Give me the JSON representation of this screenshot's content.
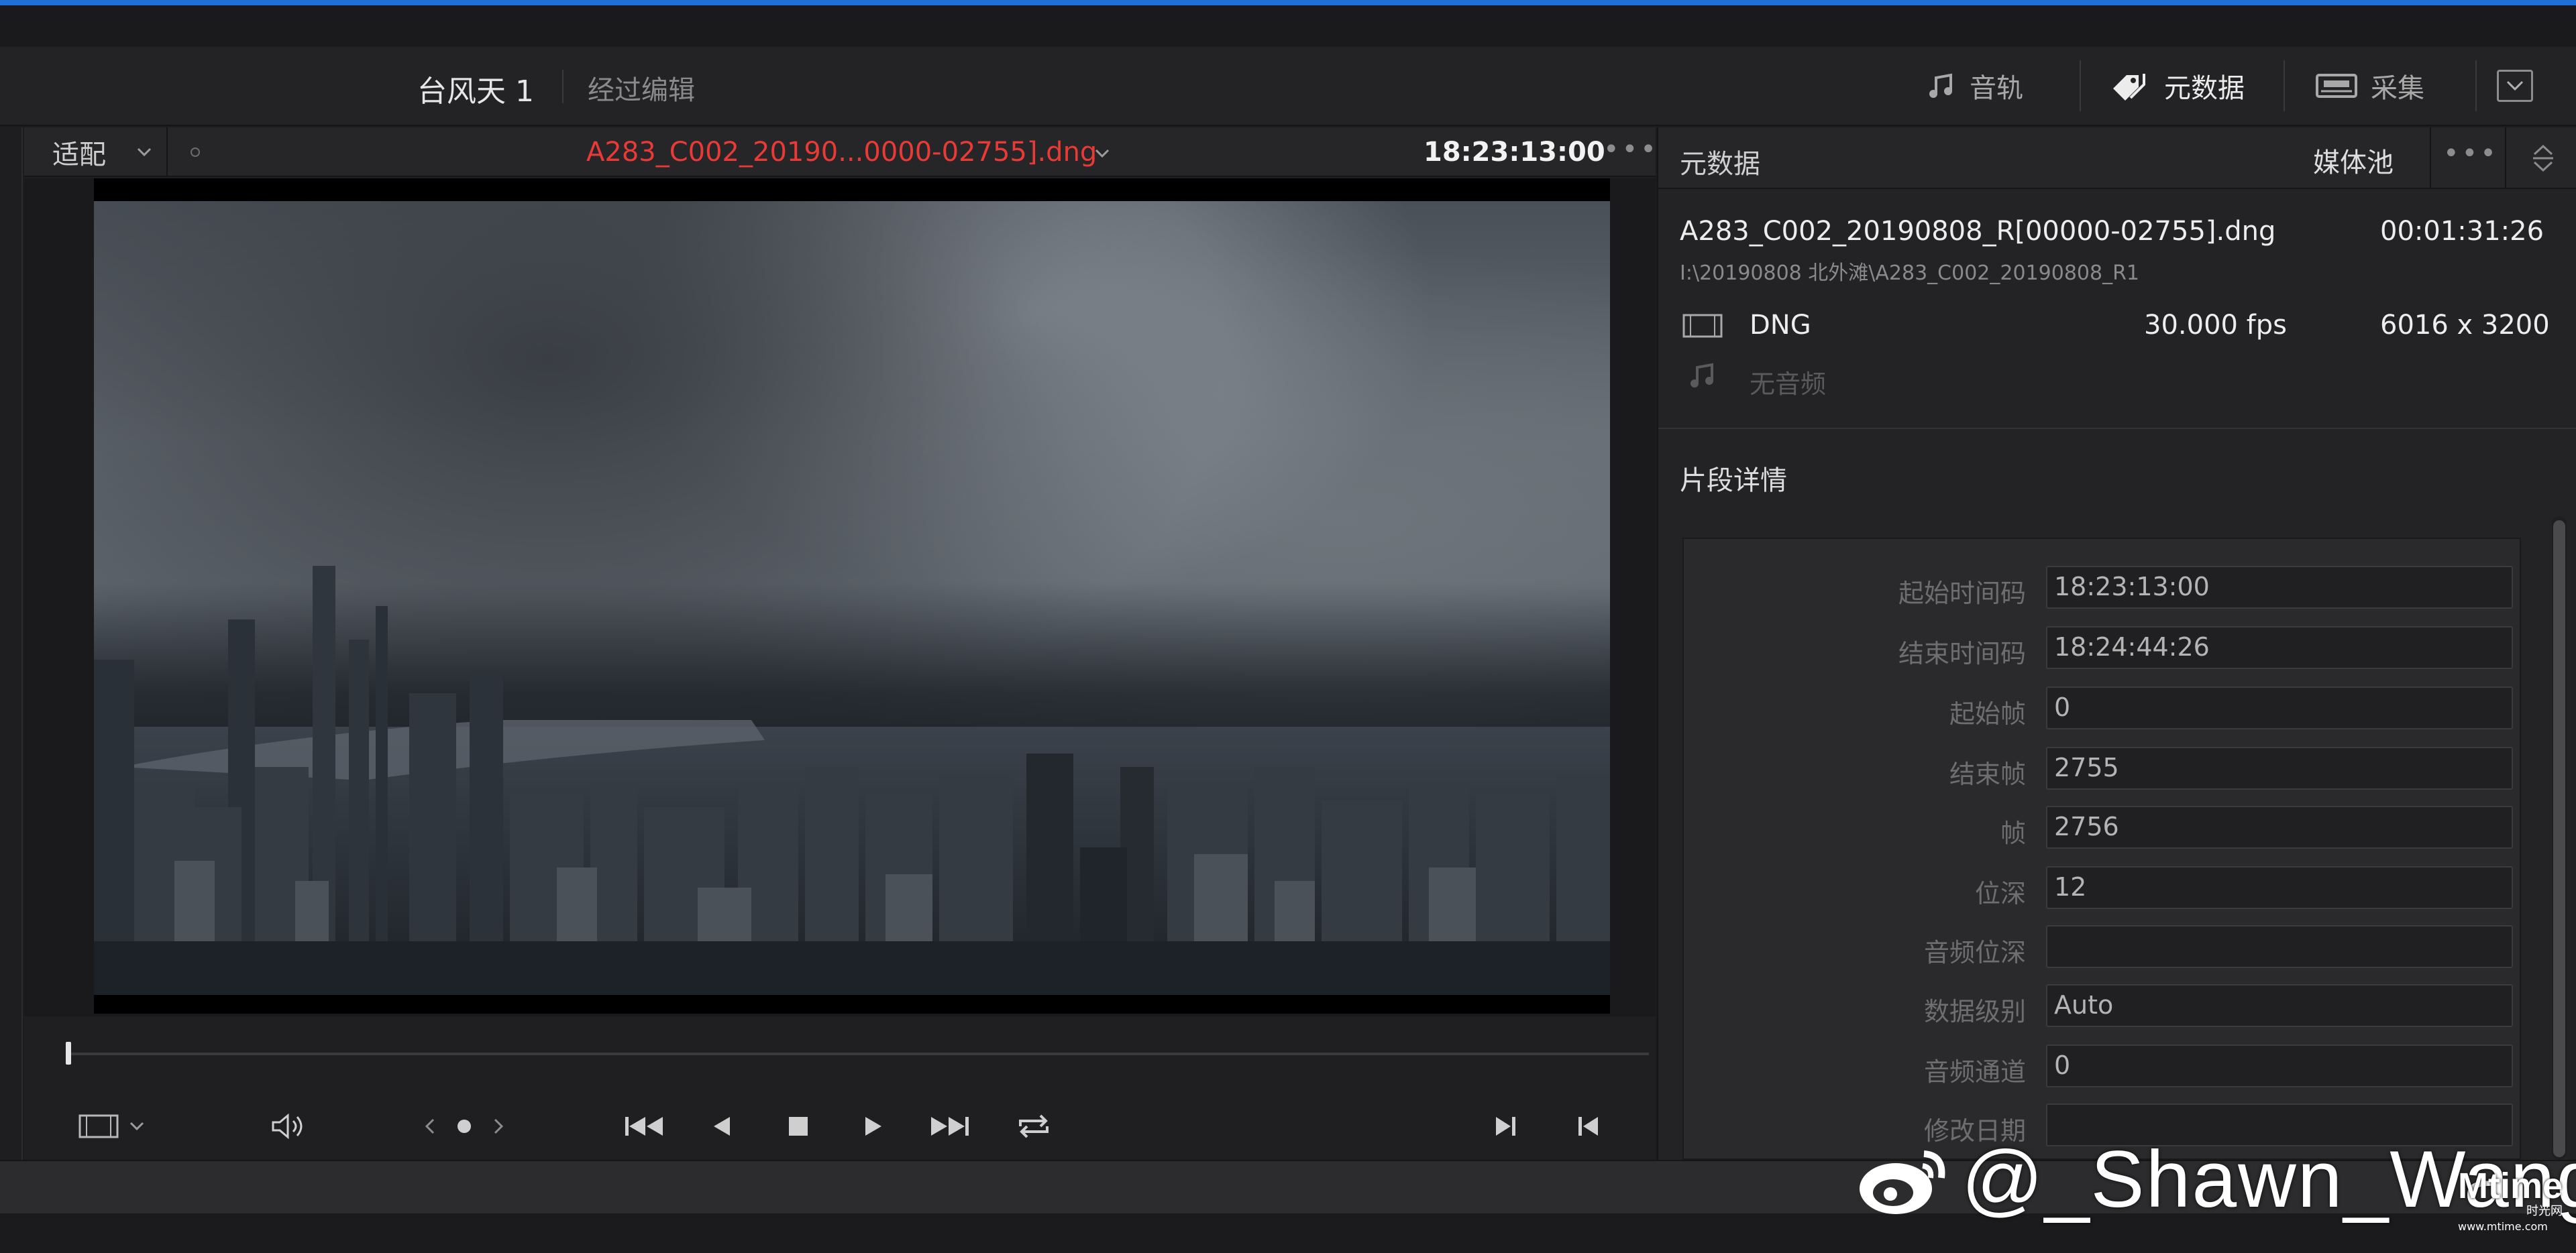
{
  "project": {
    "name": "台风天 1",
    "status": "经过编辑"
  },
  "header": {
    "audio_label": "音轨",
    "metadata_label": "元数据",
    "capture_label": "采集"
  },
  "viewer": {
    "fit_label": "适配",
    "clip_title": "A283_C002_20190...0000-02755].dng",
    "timecode": "18:23:13:00",
    "more_label": "•••"
  },
  "metadata_panel": {
    "title": "元数据",
    "media_pool_label": "媒体池",
    "more_label": "•••",
    "clip": {
      "name": "A283_C002_20190808_R[00000-02755].dng",
      "path": "I:\\20190808 北外滩\\A283_C002_20190808_R1",
      "duration": "00:01:31:26",
      "format": "DNG",
      "fps": "30.000 fps",
      "resolution": "6016 x 3200",
      "audio": "无音频"
    },
    "section_title": "片段详情",
    "fields": [
      {
        "label": "起始时间码",
        "value": "18:23:13:00"
      },
      {
        "label": "结束时间码",
        "value": "18:24:44:26"
      },
      {
        "label": "起始帧",
        "value": "0"
      },
      {
        "label": "结束帧",
        "value": "2755"
      },
      {
        "label": "帧",
        "value": "2756"
      },
      {
        "label": "位深",
        "value": "12"
      },
      {
        "label": "音频位深",
        "value": ""
      },
      {
        "label": "数据级别",
        "value": "Auto"
      },
      {
        "label": "音频通道",
        "value": "0"
      },
      {
        "label": "修改日期",
        "value": ""
      }
    ]
  },
  "watermark": {
    "text": "@_Shawn_Wang",
    "site": "Mtime",
    "site_sub": "时光网",
    "site_url": "www.mtime.com"
  },
  "colors": {
    "accent_blue": "#1f6fd6",
    "clip_title_red": "#e83a36"
  }
}
